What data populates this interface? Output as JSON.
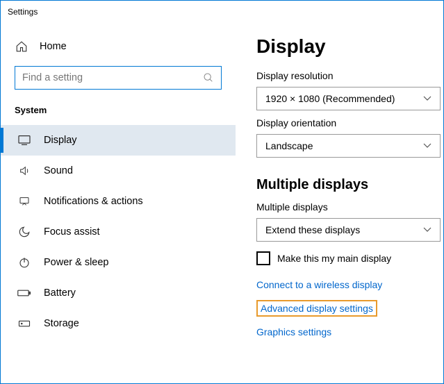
{
  "window": {
    "title": "Settings"
  },
  "sidebar": {
    "home": "Home",
    "search_placeholder": "Find a setting",
    "category": "System",
    "items": [
      {
        "label": "Display"
      },
      {
        "label": "Sound"
      },
      {
        "label": "Notifications & actions"
      },
      {
        "label": "Focus assist"
      },
      {
        "label": "Power & sleep"
      },
      {
        "label": "Battery"
      },
      {
        "label": "Storage"
      }
    ]
  },
  "main": {
    "heading": "Display",
    "resolution_label": "Display resolution",
    "resolution_value": "1920 × 1080 (Recommended)",
    "orientation_label": "Display orientation",
    "orientation_value": "Landscape",
    "multi_heading": "Multiple displays",
    "multi_label": "Multiple displays",
    "multi_value": "Extend these displays",
    "main_display_checkbox": "Make this my main display",
    "link_wireless": "Connect to a wireless display",
    "link_advanced": "Advanced display settings",
    "link_graphics": "Graphics settings"
  }
}
